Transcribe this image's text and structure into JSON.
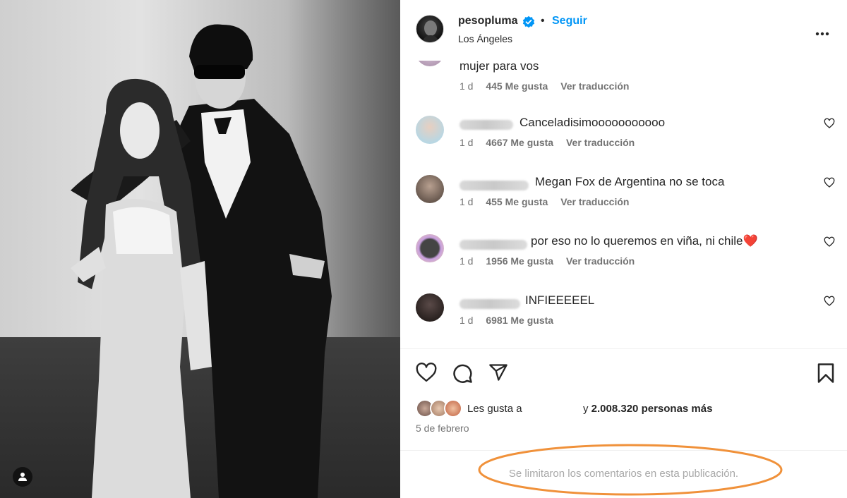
{
  "post": {
    "username": "pesopluma",
    "follow_label": "Seguir",
    "separator": "•",
    "location": "Los Ángeles"
  },
  "comments": [
    {
      "text": "mujer para vos",
      "time": "1 d",
      "likes": "445 Me gusta",
      "translate": "Ver traducción"
    },
    {
      "text": "Canceladisimooooooooooo",
      "time": "1 d",
      "likes": "4667 Me gusta",
      "translate": "Ver traducción"
    },
    {
      "text": "Megan Fox de Argentina no se toca",
      "time": "1 d",
      "likes": "455 Me gusta",
      "translate": "Ver traducción"
    },
    {
      "text": "por eso no lo queremos en viña, ni chile",
      "emoji": "❤️",
      "time": "1 d",
      "likes": "1956 Me gusta",
      "translate": "Ver traducción"
    },
    {
      "text": "INFIEEEEEL",
      "time": "1 d",
      "likes": "6981 Me gusta"
    }
  ],
  "likes": {
    "prefix": "Les gusta a",
    "suffix_pre": "y",
    "count": "2.008.320 personas más"
  },
  "date": "5 de febrero",
  "comments_limited": "Se limitaron los comentarios en esta publicación.",
  "colors": {
    "follow": "#0095f6",
    "secondary_text": "#737373",
    "annotation_ellipse": "#f0913a"
  },
  "icons": {
    "verified": "verified-badge-icon",
    "more": "more-options-icon",
    "heart": "heart-icon",
    "comment": "comment-icon",
    "share": "share-icon",
    "save": "bookmark-icon",
    "user_tag": "user-tag-icon"
  }
}
